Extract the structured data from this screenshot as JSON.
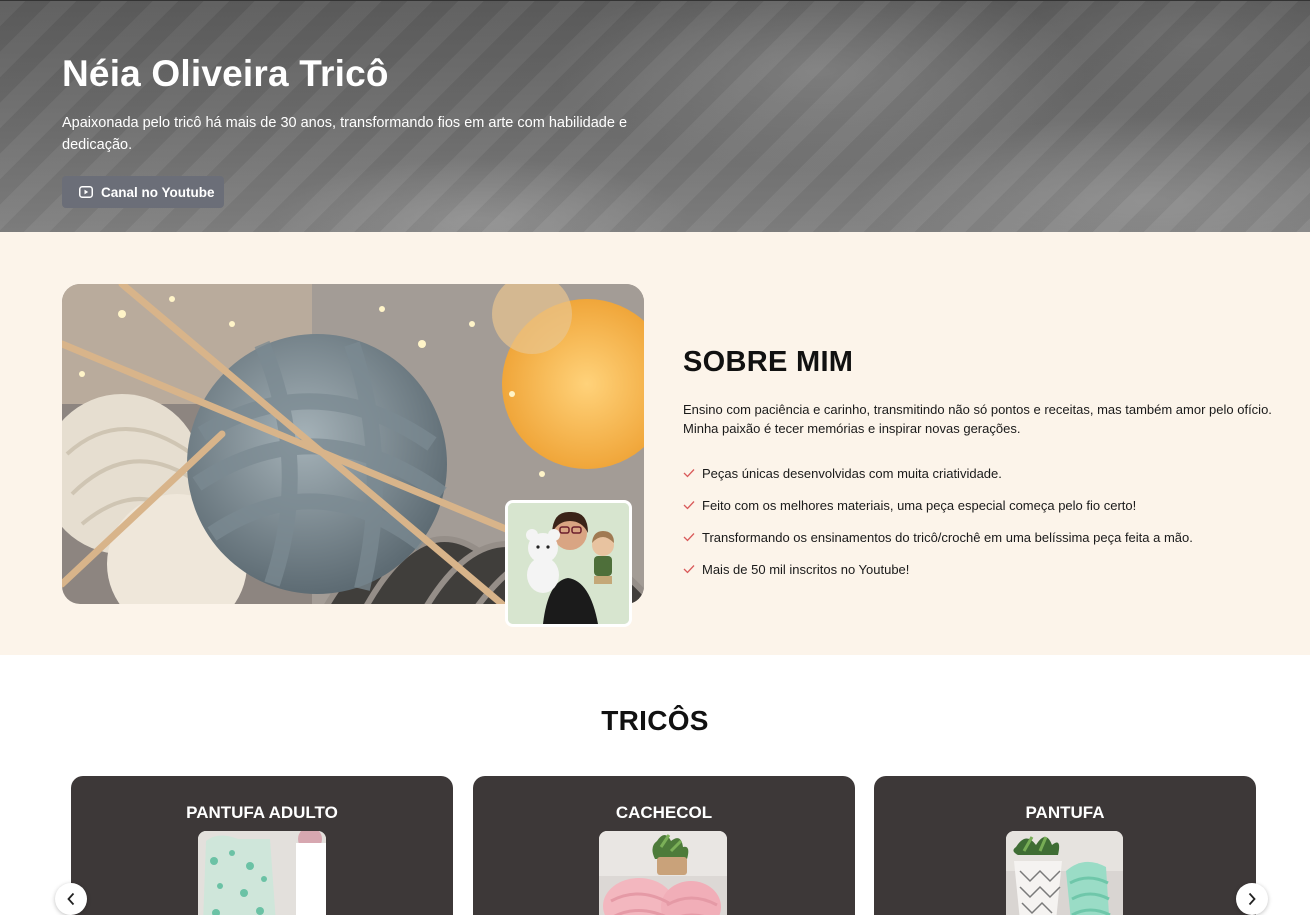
{
  "hero": {
    "title": "Néia Oliveira Tricô",
    "subtitle": "Apaixonada pelo tricô há mais de 30 anos, transformando fios em arte com habilidade e dedicação.",
    "button_label": "Canal no Youtube",
    "button_icon": "play-icon"
  },
  "about": {
    "heading": "SOBRE MIM",
    "text": "Ensino com paciência e carinho, transmitindo não só pontos e receitas, mas também amor pelo ofício. Minha paixão é tecer memórias e inspirar novas gerações.",
    "items": [
      "Peças únicas desenvolvidas com muita criatividade.",
      "Feito com os melhores materiais, uma peça especial começa pelo fio certo!",
      "Transformando os ensinamentos do tricô/crochê em uma belíssima peça feita a mão.",
      "Mais de 50 mil inscritos no Youtube!"
    ],
    "check_color": "#d95a5a"
  },
  "products": {
    "title": "TRICÔS",
    "cards": [
      {
        "title": "PANTUFA ADULTO"
      },
      {
        "title": "CACHECOL"
      },
      {
        "title": "PANTUFA"
      }
    ]
  },
  "colors": {
    "card_bg": "#3d3838",
    "about_bg": "#fcf4ea",
    "button_bg": "#6b6e78"
  }
}
